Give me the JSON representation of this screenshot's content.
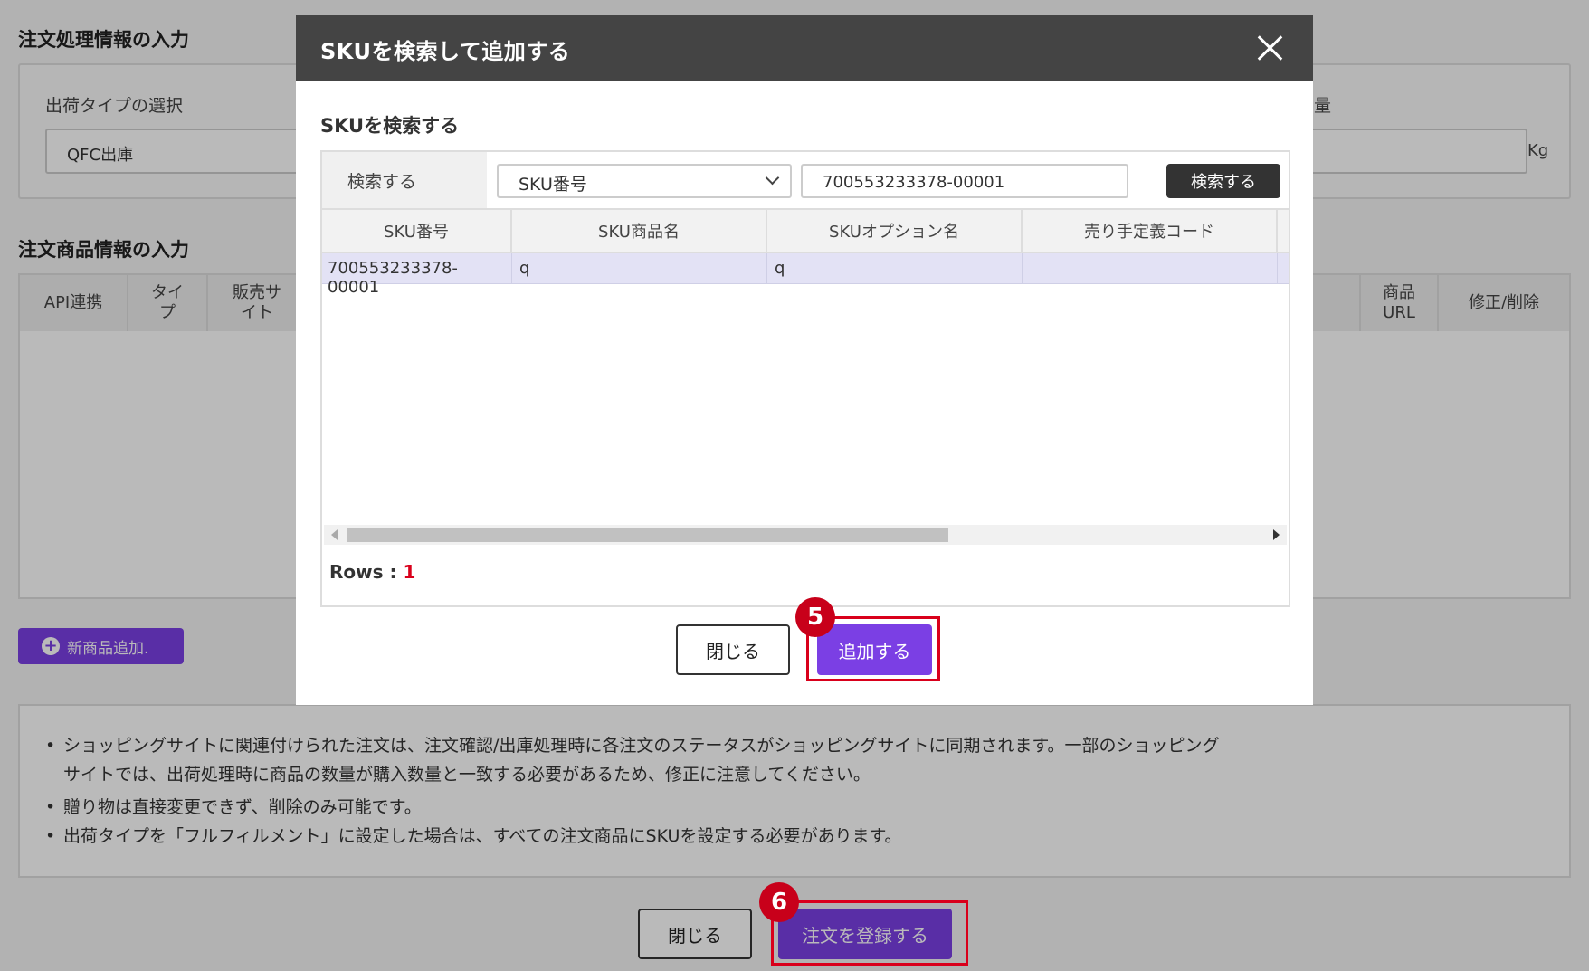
{
  "page": {
    "order_section_title": "注文処理情報の入力",
    "shipping_type_label": "出荷タイプの選択",
    "shipping_type_value": "QFC出庫",
    "weight_label_fragment": "量",
    "weight_unit": "Kg",
    "product_section_title": "注文商品情報の入力",
    "grid_columns": {
      "api": "API連携",
      "type": "タイプ",
      "sales_site": "販売サイト",
      "product_url": "商品URL",
      "edit_delete": "修正/削除"
    },
    "add_product_button": "新商品追加.",
    "notes": [
      "ショッピングサイトに関連付けられた注文は、注文確認/出庫処理時に各注文のステータスがショッピングサイトに同期されます。一部のショッピングサイトでは、出荷処理時に商品の数量が購入数量と一致する必要があるため、修正に注意してください。",
      "贈り物は直接変更できず、削除のみ可能です。",
      "出荷タイプを「フルフィルメント」に設定した場合は、すべての注文商品にSKUを設定する必要があります。"
    ],
    "close_button": "閉じる",
    "register_button": "注文を登録する"
  },
  "modal": {
    "title": "SKUを検索して追加する",
    "subtitle": "SKUを検索する",
    "search_label": "検索する",
    "search_type_selected": "SKU番号",
    "search_value": "700553233378-00001",
    "search_button": "検索する",
    "columns": [
      "SKU番号",
      "SKU商品名",
      "SKUオプション名",
      "売り手定義コード"
    ],
    "rows": [
      [
        "700553233378-00001",
        "q",
        "q",
        ""
      ]
    ],
    "rows_label": "Rows : ",
    "rows_count": "1",
    "close_button": "閉じる",
    "add_button": "追加する"
  },
  "steps": [
    "5",
    "6"
  ],
  "colors": {
    "accent_purple": "#7b3fe4",
    "highlight_red": "#d9001b",
    "header_dark": "#444444",
    "selected_row": "#e3e2f5"
  },
  "icons": [
    "close-icon",
    "chevron-down-icon",
    "plus-circle-icon",
    "scroll-left-icon",
    "scroll-right-icon"
  ]
}
